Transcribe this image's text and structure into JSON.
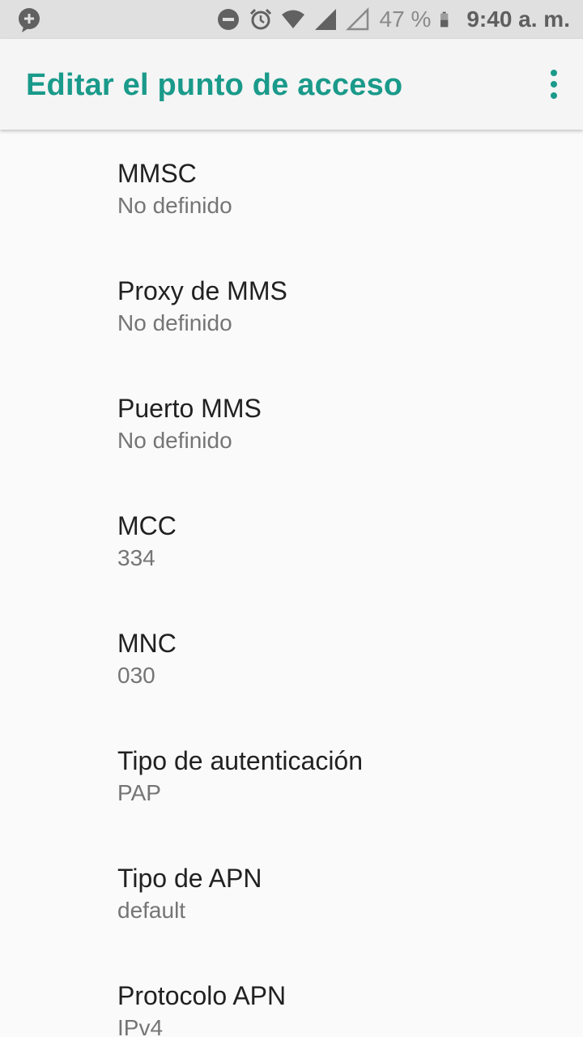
{
  "status_bar": {
    "left_icon": "notification-add-icon",
    "icons": [
      "do-not-disturb-icon",
      "alarm-icon",
      "wifi-icon",
      "signal-icon",
      "signal-empty-icon"
    ],
    "battery_percent": "47 %",
    "battery_icon": "battery-icon",
    "time": "9:40 a. m."
  },
  "app_bar": {
    "title": "Editar el punto de acceso",
    "menu_icon": "more-vert-icon",
    "accent_color": "#1a9a8a"
  },
  "settings": [
    {
      "label": "MMSC",
      "value": "No definido"
    },
    {
      "label": "Proxy de MMS",
      "value": "No definido"
    },
    {
      "label": "Puerto MMS",
      "value": "No definido"
    },
    {
      "label": "MCC",
      "value": "334"
    },
    {
      "label": "MNC",
      "value": "030"
    },
    {
      "label": "Tipo de autenticación",
      "value": "PAP"
    },
    {
      "label": "Tipo de APN",
      "value": "default"
    },
    {
      "label": "Protocolo APN",
      "value": "IPv4"
    }
  ]
}
